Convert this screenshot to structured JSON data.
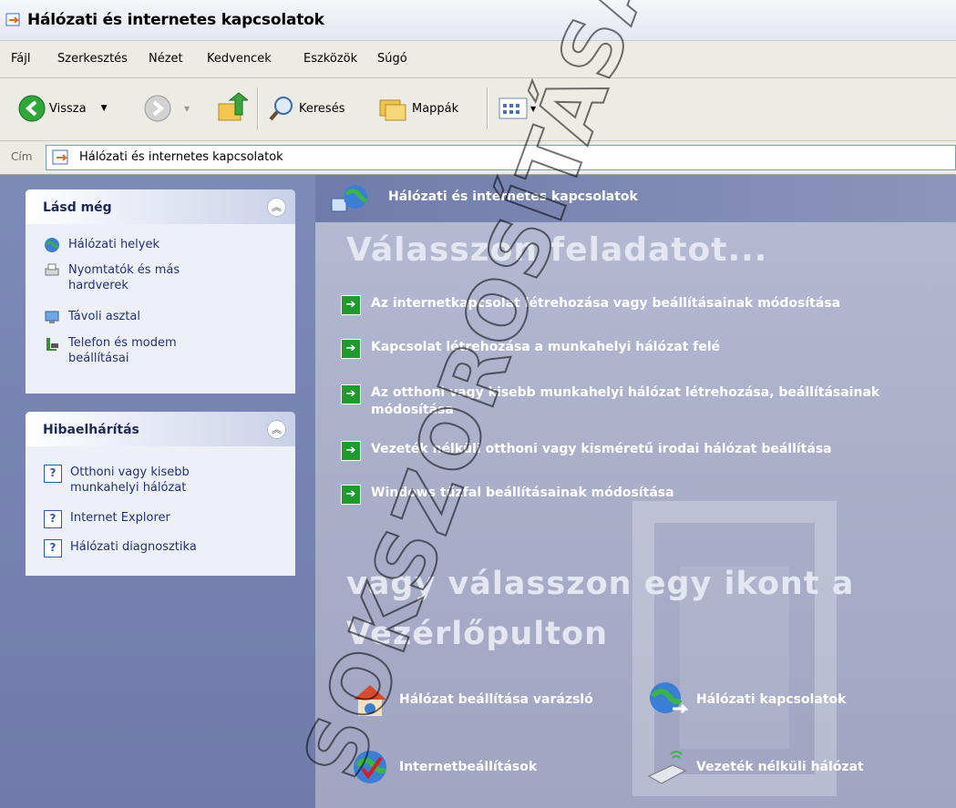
{
  "window": {
    "title": "Hálózati és internetes kapcsolatok"
  },
  "menu": [
    "Fájl",
    "Szerkesztés",
    "Nézet",
    "Kedvencek",
    "Eszközök",
    "Súgó"
  ],
  "toolbar": {
    "back": "Vissza",
    "search": "Keresés",
    "folders": "Mappák"
  },
  "address": {
    "label": "Cím",
    "value": "Hálózati és internetes kapcsolatok"
  },
  "see_also": {
    "title": "Lásd még",
    "items": [
      "Hálózati helyek",
      "Nyomtatók és más hardverek",
      "Távoli asztal",
      "Telefon és modem beállításai"
    ]
  },
  "troubleshoot": {
    "title": "Hibaelhárítás",
    "items": [
      "Otthoni vagy kisebb munkahelyi hálózat",
      "Internet Explorer",
      "Hálózati diagnosztika"
    ]
  },
  "main": {
    "header": "Hálózati és internetes kapcsolatok",
    "pick_task": "Válasszon feladatot...",
    "tasks": [
      "Az internetkapcsolat létrehozása vagy beállításainak módosítása",
      "Kapcsolat létrehozása a munkahelyi hálózat felé",
      "Az otthoni vagy kisebb munkahelyi hálózat létrehozása, beállításainak módosítása",
      "Vezeték nélküli otthoni vagy kisméretű irodai hálózat beállítása",
      "Windows tűzfal beállításainak módosítása"
    ],
    "pick_icon": "vagy válasszon egy ikont a Vezérlőpulton",
    "icons": [
      "Hálózat beállítása varázsló",
      "Hálózati kapcsolatok",
      "Internetbeállítások",
      "Vezeték nélküli hálózat"
    ]
  },
  "watermark": "SOKSZOROSÍTÁSA ÉS TÁRSA ZRT.",
  "colors": {
    "sidebar_bg": "#7b88b4",
    "main_bg": "#b0b5cf",
    "task_arrow": "#1f9b2e"
  }
}
